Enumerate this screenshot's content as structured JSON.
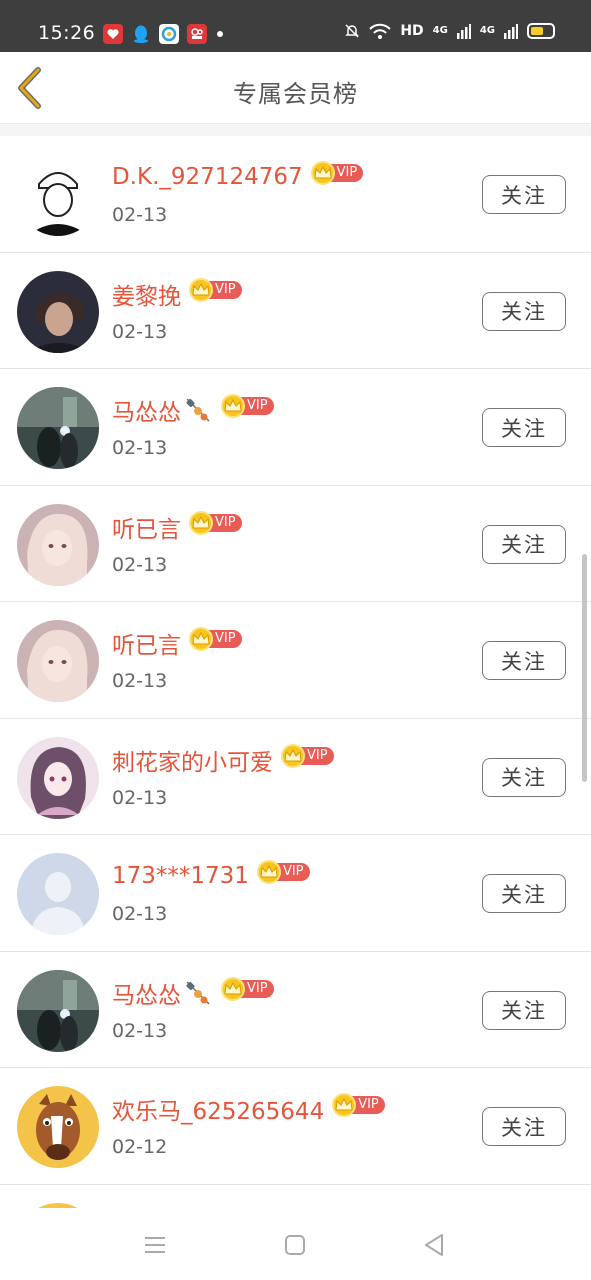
{
  "status_bar": {
    "time": "15:26",
    "hd_label": "HD",
    "signal_1": "4G",
    "signal_2": "4G"
  },
  "header": {
    "title": "专属会员榜"
  },
  "vip_label": "VIP",
  "follow_label": "关注",
  "members": [
    {
      "name": "D.K._927124767",
      "date": "02-13",
      "avatar": "sketch-boy"
    },
    {
      "name": "姜黎挽",
      "date": "02-13",
      "avatar": "dark-portrait"
    },
    {
      "name": "马怂怂",
      "date": "02-13",
      "avatar": "night-photo",
      "name_icon": "skewer-icon"
    },
    {
      "name": "听已言",
      "date": "02-13",
      "avatar": "pink-girl"
    },
    {
      "name": "听已言",
      "date": "02-13",
      "avatar": "pink-girl"
    },
    {
      "name": "刺花家的小可爱",
      "date": "02-13",
      "avatar": "anime-girl"
    },
    {
      "name": "173***1731",
      "date": "02-13",
      "avatar": "default-person"
    },
    {
      "name": "马怂怂",
      "date": "02-13",
      "avatar": "night-photo",
      "name_icon": "skewer-icon"
    },
    {
      "name": "欢乐马_625265644",
      "date": "02-12",
      "avatar": "cartoon-horse"
    }
  ],
  "colors": {
    "name": "#e6553a",
    "vip_tag": "#e95b55",
    "crown": "#f8c51e",
    "back_arrow": "#e6a817"
  }
}
